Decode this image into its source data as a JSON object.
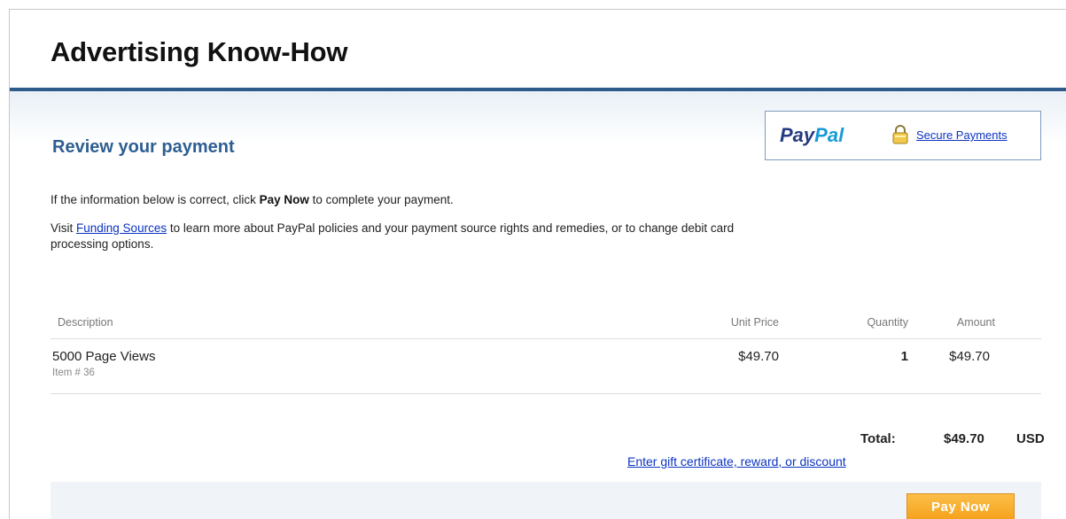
{
  "store": {
    "title": "Advertising Know-How"
  },
  "review": {
    "title": "Review your payment"
  },
  "paypal": {
    "logo_pay": "Pay",
    "logo_pal": "Pal",
    "secure_label": "Secure Payments",
    "icon": "lock-icon"
  },
  "info": {
    "line1_before": "If the information below is correct, click ",
    "line1_bold": "Pay Now",
    "line1_after": " to complete your payment.",
    "line2_before": "Visit ",
    "line2_link": "Funding Sources",
    "line2_after": " to learn more about PayPal policies and your payment source rights and remedies, or to change debit card processing options."
  },
  "table": {
    "headers": {
      "description": "Description",
      "unit_price": "Unit Price",
      "quantity": "Quantity",
      "amount": "Amount"
    },
    "rows": [
      {
        "name": "5000 Page Views",
        "item_number": "Item # 36",
        "unit_price": "$49.70",
        "quantity": "1",
        "amount": "$49.70"
      }
    ]
  },
  "totals": {
    "label": "Total:",
    "value": "$49.70",
    "currency": "USD",
    "gift_link": "Enter gift certificate, reward, or discount"
  },
  "actions": {
    "pay_now": "Pay Now"
  },
  "colors": {
    "header_bar": "#2e5a8c",
    "title_blue": "#2d5e92",
    "link_blue": "#0b33c2",
    "button_orange": "#f5a21c"
  }
}
